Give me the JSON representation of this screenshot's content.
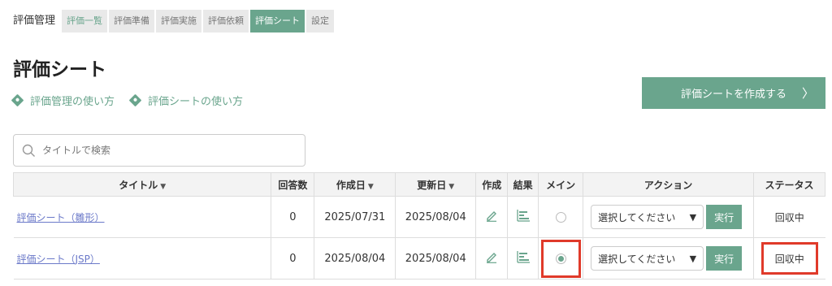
{
  "nav": {
    "module": "評価管理",
    "tabs": [
      "評価一覧",
      "評価準備",
      "評価実施",
      "評価依頼",
      "評価シート",
      "設定"
    ]
  },
  "page": {
    "title": "評価シート",
    "help_links": [
      "評価管理の使い方",
      "評価シートの使い方"
    ],
    "create_button": "評価シートを作成する",
    "create_chevron": "〉"
  },
  "search": {
    "placeholder": "タイトルで検索"
  },
  "table": {
    "headers": {
      "title": "タイトル",
      "answers": "回答数",
      "created": "作成日",
      "updated": "更新日",
      "create": "作成",
      "result": "結果",
      "main": "メイン",
      "action": "アクション",
      "status": "ステータス"
    },
    "sort_arrow": "▼",
    "rows": [
      {
        "title": "評価シート（雛形）",
        "answers": "0",
        "created": "2025/07/31",
        "updated": "2025/08/04",
        "main_selected": false,
        "action_select": "選択してください",
        "action_button": "実行",
        "status": "回収中"
      },
      {
        "title": "評価シート（JSP）",
        "answers": "0",
        "created": "2025/08/04",
        "updated": "2025/08/04",
        "main_selected": true,
        "action_select": "選択してください",
        "action_button": "実行",
        "status": "回収中"
      }
    ]
  },
  "colors": {
    "accent": "#6aa58d",
    "highlight": "#e03a2a",
    "link": "#6b79c9"
  },
  "icons": [
    "diamond-help-icon",
    "search-icon",
    "pencil-edit-icon",
    "bar-chart-result-icon",
    "chevron-right-icon",
    "caret-down-icon"
  ]
}
